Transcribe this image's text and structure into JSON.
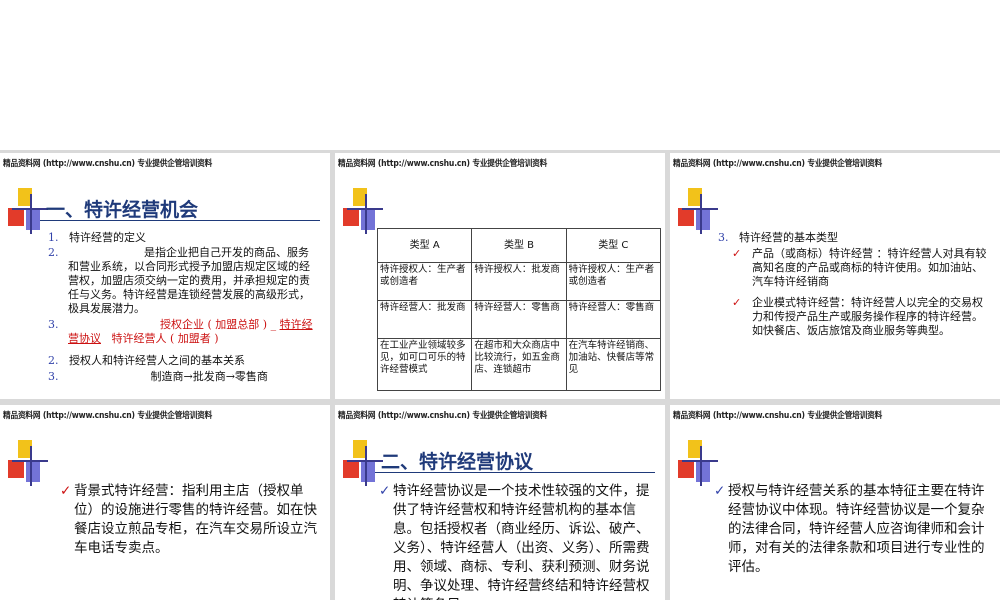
{
  "header": "精品资料网 (http://www.cnshu.cn) 专业提供企管培训资料",
  "slide1": {
    "title": "一、特许经营机会",
    "items": [
      {
        "num": "1.",
        "text": "特许经营的定义"
      },
      {
        "num": "2.",
        "text": "是指企业把自己开发的商品、服务和营业系统，以合同形式授予加盟店规定区域的经营权，加盟店须交纳一定的费用，并承担规定的责任与义务。特许经营是连锁经营发展的高级形式，极具发展潜力。"
      },
      {
        "num": "3.",
        "red1": "授权企业 ( 加盟总部 ) ",
        "red2": "特许经营协议",
        "red3": "特许经营人 ( 加盟者 )"
      },
      {
        "num": "2.",
        "text": "授权人和特许经营人之间的基本关系"
      },
      {
        "num": "3.",
        "text": "制造商→批发商→零售商"
      }
    ]
  },
  "slide2": {
    "headers": [
      "类型 A",
      "类型 B",
      "类型 C"
    ],
    "rows": [
      [
        "特许授权人：生产者或创造者",
        "特许授权人：批发商",
        "特许授权人：生产者或创造者"
      ],
      [
        "特许经营人：批发商",
        "特许经营人：零售商",
        "特许经营人：零售商"
      ],
      [
        "在工业产业领域较多见，如可口可乐的特许经营模式",
        "在超市和大众商店中比较流行，如五金商店、连锁超市",
        "在汽车特许经销商、加油站、快餐店等常见"
      ]
    ]
  },
  "slide3": {
    "num": "3.",
    "heading": "特许经营的基本类型",
    "bullets": [
      "产品（或商标）特许经营 ：特许经营人对具有较高知名度的产品或商标的特许使用。如加油站、汽车特许经销商",
      "企业模式特许经营：特许经营人以完全的交易权力和传授产品生产或服务操作程序的特许经营。如快餐店、饭店旅馆及商业服务等典型。"
    ]
  },
  "slide4": {
    "text": "背景式特许经营：指利用主店（授权单位）的设施进行零售的特许经营。如在快餐店设立煎品专柜，在汽车交易所设立汽车电话专卖点。"
  },
  "slide5": {
    "title": "二、特许经营协议",
    "text": "特许经营协议是一个技术性较强的文件，提供了特许经营权和特许经营机构的基本信息。包括授权者（商业经历、诉讼、破产、义务）、特许经营人（出资、义务）、所需费用、领域、商标、专利、获利预测、财务说明、争议处理、特许经营终结和特许经营权转让等条目。"
  },
  "slide6": {
    "text": "授权与特许经营关系的基本特征主要在特许经营协议中体现。特许经营协议是一个复杂的法律合同，特许经营人应咨询律师和会计师，对有关的法律条款和项目进行专业性的评估。"
  },
  "colors": {
    "title": "#1f3a7a",
    "accent_red": "#cc1111",
    "check": "#cc1111"
  },
  "icons": [
    "logo-blocks-icon",
    "checkmark-icon"
  ]
}
